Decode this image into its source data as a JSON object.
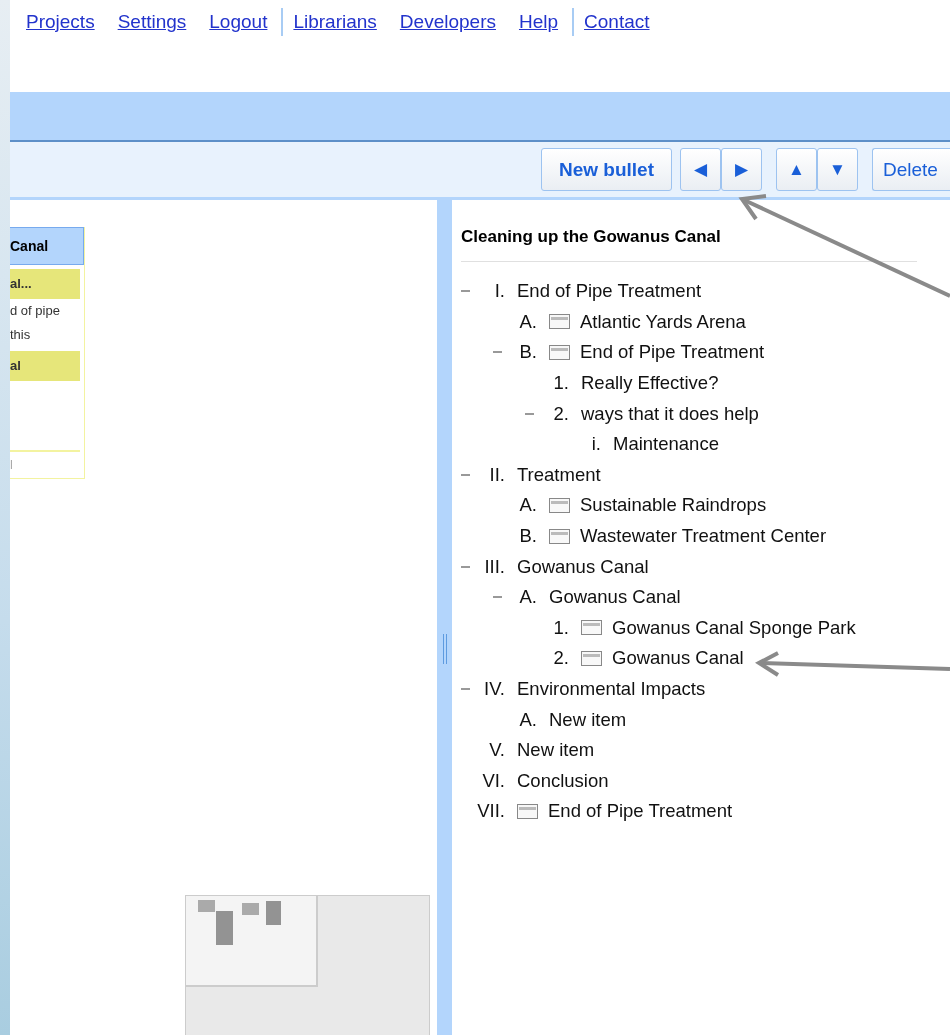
{
  "nav": {
    "groups": [
      [
        "Projects",
        "Settings",
        "Logout"
      ],
      [
        "Librarians",
        "Developers",
        "Help"
      ],
      [
        "Contact"
      ]
    ]
  },
  "toolbar": {
    "new_bullet": "New bullet",
    "indent_buttons": [
      "◀",
      "▶"
    ],
    "move_buttons": [
      "▲",
      "▼"
    ],
    "delete": "Delete"
  },
  "left_card": {
    "header": "Canal",
    "rows": [
      {
        "text": "al...",
        "kind": "highlight"
      },
      {
        "text": "d of pipe",
        "kind": "plain"
      },
      {
        "text": "this",
        "kind": "plain"
      },
      {
        "text": "al",
        "kind": "highlight"
      }
    ],
    "footer": "l"
  },
  "outline": {
    "title": "Cleaning up the Gowanus Canal",
    "items": [
      {
        "number": "I.",
        "text": "End of Pipe Treatment",
        "has_note": false,
        "expanded": true,
        "children": [
          {
            "number": "A.",
            "text": "Atlantic Yards Arena",
            "has_note": true,
            "expanded": false
          },
          {
            "number": "B.",
            "text": "End of Pipe Treatment",
            "has_note": true,
            "expanded": true,
            "children": [
              {
                "number": "1.",
                "text": "Really Effective?",
                "has_note": false,
                "expanded": false
              },
              {
                "number": "2.",
                "text": "ways that it does help",
                "has_note": false,
                "expanded": true,
                "children": [
                  {
                    "number": "i.",
                    "text": "Maintenance",
                    "has_note": false,
                    "expanded": false
                  }
                ]
              }
            ]
          }
        ]
      },
      {
        "number": "II.",
        "text": "Treatment",
        "has_note": false,
        "expanded": true,
        "children": [
          {
            "number": "A.",
            "text": "Sustainable Raindrops",
            "has_note": true,
            "expanded": false
          },
          {
            "number": "B.",
            "text": "Wastewater Treatment Center",
            "has_note": true,
            "expanded": false
          }
        ]
      },
      {
        "number": "III.",
        "text": "Gowanus Canal",
        "has_note": false,
        "expanded": true,
        "children": [
          {
            "number": "A.",
            "text": "Gowanus Canal",
            "has_note": false,
            "expanded": true,
            "children": [
              {
                "number": "1.",
                "text": "Gowanus Canal Sponge Park",
                "has_note": true,
                "expanded": false
              },
              {
                "number": "2.",
                "text": "Gowanus Canal",
                "has_note": true,
                "expanded": false
              }
            ]
          }
        ]
      },
      {
        "number": "IV.",
        "text": "Environmental Impacts",
        "has_note": false,
        "expanded": true,
        "children": [
          {
            "number": "A.",
            "text": "New item",
            "has_note": false,
            "expanded": false
          }
        ]
      },
      {
        "number": "V.",
        "text": "New item",
        "has_note": false,
        "expanded": false
      },
      {
        "number": "VI.",
        "text": "Conclusion",
        "has_note": false,
        "expanded": false
      },
      {
        "number": "VII.",
        "text": "End of Pipe Treatment",
        "has_note": true,
        "expanded": false
      }
    ]
  }
}
